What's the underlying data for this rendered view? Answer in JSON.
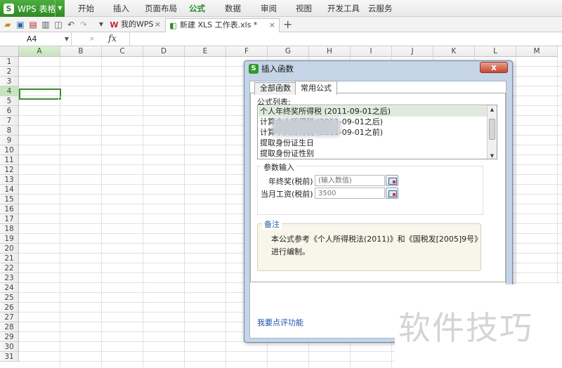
{
  "app": {
    "button_label": "WPS 表格",
    "logo_letter": "S"
  },
  "menu": {
    "items": [
      "开始",
      "插入",
      "页面布局",
      "公式",
      "数据",
      "审阅",
      "视图",
      "开发工具",
      "云服务"
    ],
    "active": "公式"
  },
  "tabs": {
    "my_wps": "我的WPS",
    "document": "新建 XLS 工作表.xls *",
    "close_glyph": "×",
    "add_glyph": "+"
  },
  "formula_bar": {
    "cell_ref": "A4",
    "fx_label": "fx"
  },
  "grid": {
    "columns": [
      "A",
      "B",
      "C",
      "D",
      "E",
      "F",
      "G",
      "H",
      "I",
      "J",
      "K",
      "L",
      "M"
    ],
    "selected_column": "A",
    "rows": [
      "1",
      "2",
      "3",
      "4",
      "5",
      "6",
      "7",
      "8",
      "9",
      "10",
      "11",
      "12",
      "13",
      "14",
      "15",
      "16",
      "17",
      "18",
      "19",
      "20",
      "21",
      "22",
      "23",
      "24",
      "25",
      "26",
      "27",
      "28",
      "29",
      "30",
      "31"
    ],
    "selected_row": "4"
  },
  "dialog": {
    "title": "插入函数",
    "close_glyph": "x",
    "tabs": [
      "全部函数",
      "常用公式"
    ],
    "active_tab": "常用公式",
    "list_label": "公式列表:",
    "formula_list": [
      "个人年终奖所得税 (2011-09-01之后)",
      "计算个人所得税 (2011-09-01之后)",
      "计算个人所得税 (2011-09-01之前)",
      "提取身份证生日",
      "提取身份证性别"
    ],
    "selected_index": 0,
    "param_section_title": "参数输入",
    "params": [
      {
        "label": "年终奖(税前)",
        "value": "",
        "placeholder": "(输入数值)"
      },
      {
        "label": "当月工资(税前)",
        "value": "3500",
        "placeholder": ""
      }
    ],
    "note_title": "备注",
    "note_text_line1": "本公式参考《个人所得税法(2011)》和《国税发[2005]9号》",
    "note_text_line2": "进行编制。",
    "feedback_link": "我要点评功能"
  },
  "watermark": "软件技巧",
  "colors": {
    "accent_green": "#2f8a25",
    "selection_green": "#3e8e2e",
    "dialog_frame": "#c5d4e7",
    "close_red": "#c8452d",
    "link_blue": "#1f4fa8"
  }
}
